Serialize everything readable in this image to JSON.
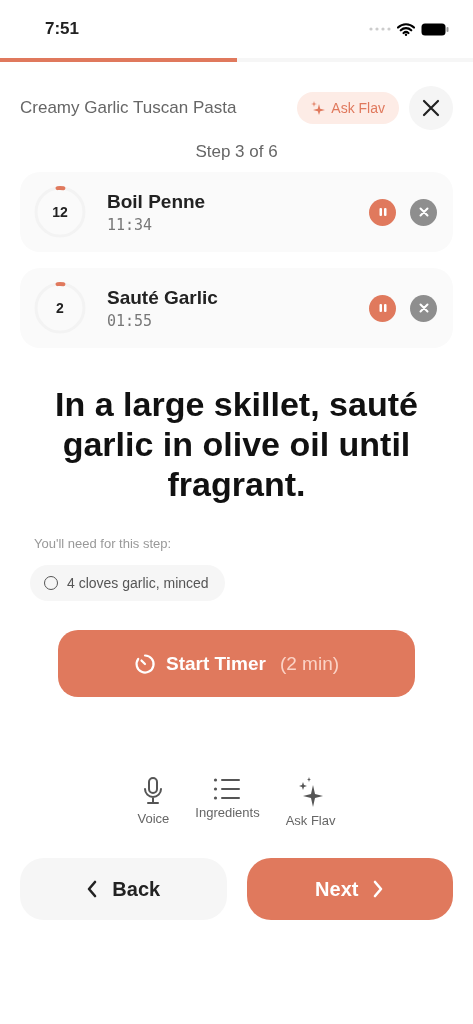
{
  "status_bar": {
    "time": "7:51"
  },
  "progress": {
    "level": 0.5
  },
  "header": {
    "title": "Creamy Garlic Tuscan Pasta",
    "ask_button": "Ask Flav"
  },
  "step_label": "Step 3 of 6",
  "timers": [
    {
      "minutes": "12",
      "name": "Boil Penne",
      "remaining": "11:34",
      "level": 0.04
    },
    {
      "minutes": "2",
      "name": "Sauté Garlic",
      "remaining": "01:55",
      "level": 0.04
    }
  ],
  "instruction": "In a large skillet, sauté garlic in olive oil until fragrant.",
  "needs_label": "You'll need for this step:",
  "ingredients": [
    {
      "text": "4 cloves garlic, minced",
      "checked": false
    }
  ],
  "timer_button": {
    "label": "Start Timer",
    "duration": "(2 min)"
  },
  "tools": [
    {
      "kind": "voice",
      "label": "Voice"
    },
    {
      "kind": "list",
      "label": "Ingredients"
    },
    {
      "kind": "sparkle",
      "label": "Ask Flav"
    }
  ],
  "nav": {
    "back": "Back",
    "next": "Next"
  }
}
